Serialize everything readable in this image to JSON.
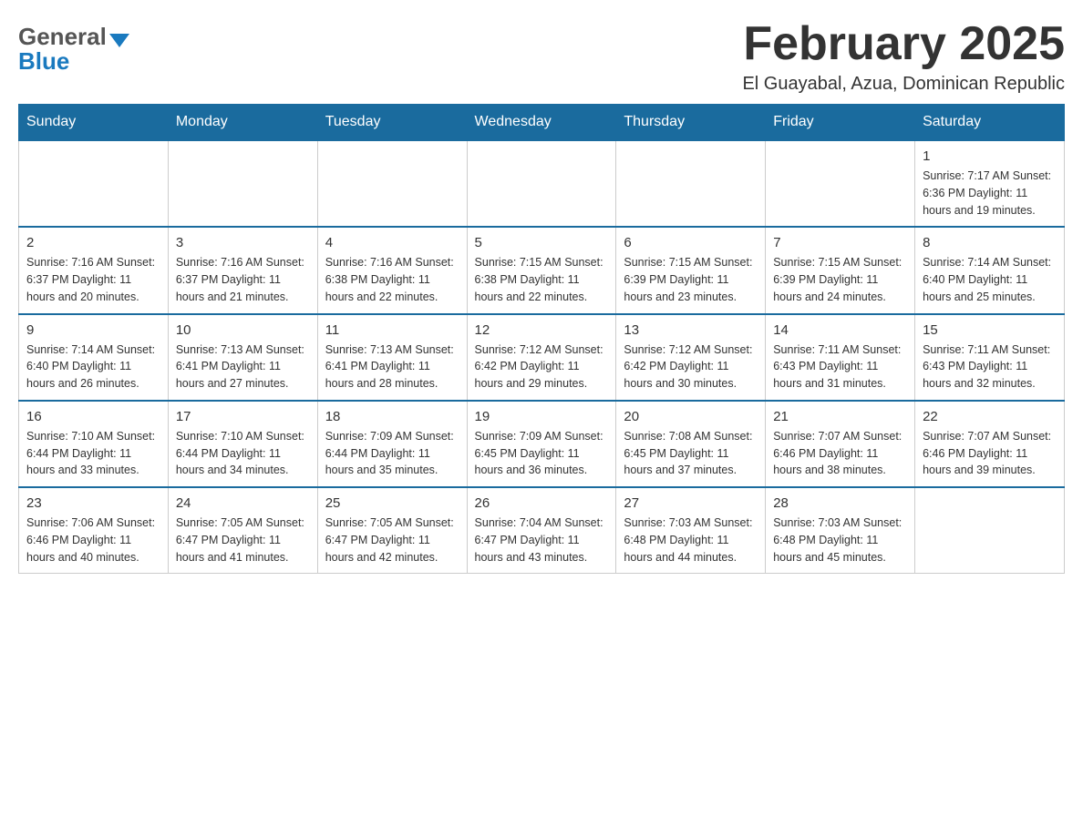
{
  "header": {
    "logo_line1": "General",
    "logo_line2": "Blue",
    "month_title": "February 2025",
    "location": "El Guayabal, Azua, Dominican Republic"
  },
  "weekdays": [
    "Sunday",
    "Monday",
    "Tuesday",
    "Wednesday",
    "Thursday",
    "Friday",
    "Saturday"
  ],
  "weeks": [
    [
      {
        "day": "",
        "info": ""
      },
      {
        "day": "",
        "info": ""
      },
      {
        "day": "",
        "info": ""
      },
      {
        "day": "",
        "info": ""
      },
      {
        "day": "",
        "info": ""
      },
      {
        "day": "",
        "info": ""
      },
      {
        "day": "1",
        "info": "Sunrise: 7:17 AM\nSunset: 6:36 PM\nDaylight: 11 hours and 19 minutes."
      }
    ],
    [
      {
        "day": "2",
        "info": "Sunrise: 7:16 AM\nSunset: 6:37 PM\nDaylight: 11 hours and 20 minutes."
      },
      {
        "day": "3",
        "info": "Sunrise: 7:16 AM\nSunset: 6:37 PM\nDaylight: 11 hours and 21 minutes."
      },
      {
        "day": "4",
        "info": "Sunrise: 7:16 AM\nSunset: 6:38 PM\nDaylight: 11 hours and 22 minutes."
      },
      {
        "day": "5",
        "info": "Sunrise: 7:15 AM\nSunset: 6:38 PM\nDaylight: 11 hours and 22 minutes."
      },
      {
        "day": "6",
        "info": "Sunrise: 7:15 AM\nSunset: 6:39 PM\nDaylight: 11 hours and 23 minutes."
      },
      {
        "day": "7",
        "info": "Sunrise: 7:15 AM\nSunset: 6:39 PM\nDaylight: 11 hours and 24 minutes."
      },
      {
        "day": "8",
        "info": "Sunrise: 7:14 AM\nSunset: 6:40 PM\nDaylight: 11 hours and 25 minutes."
      }
    ],
    [
      {
        "day": "9",
        "info": "Sunrise: 7:14 AM\nSunset: 6:40 PM\nDaylight: 11 hours and 26 minutes."
      },
      {
        "day": "10",
        "info": "Sunrise: 7:13 AM\nSunset: 6:41 PM\nDaylight: 11 hours and 27 minutes."
      },
      {
        "day": "11",
        "info": "Sunrise: 7:13 AM\nSunset: 6:41 PM\nDaylight: 11 hours and 28 minutes."
      },
      {
        "day": "12",
        "info": "Sunrise: 7:12 AM\nSunset: 6:42 PM\nDaylight: 11 hours and 29 minutes."
      },
      {
        "day": "13",
        "info": "Sunrise: 7:12 AM\nSunset: 6:42 PM\nDaylight: 11 hours and 30 minutes."
      },
      {
        "day": "14",
        "info": "Sunrise: 7:11 AM\nSunset: 6:43 PM\nDaylight: 11 hours and 31 minutes."
      },
      {
        "day": "15",
        "info": "Sunrise: 7:11 AM\nSunset: 6:43 PM\nDaylight: 11 hours and 32 minutes."
      }
    ],
    [
      {
        "day": "16",
        "info": "Sunrise: 7:10 AM\nSunset: 6:44 PM\nDaylight: 11 hours and 33 minutes."
      },
      {
        "day": "17",
        "info": "Sunrise: 7:10 AM\nSunset: 6:44 PM\nDaylight: 11 hours and 34 minutes."
      },
      {
        "day": "18",
        "info": "Sunrise: 7:09 AM\nSunset: 6:44 PM\nDaylight: 11 hours and 35 minutes."
      },
      {
        "day": "19",
        "info": "Sunrise: 7:09 AM\nSunset: 6:45 PM\nDaylight: 11 hours and 36 minutes."
      },
      {
        "day": "20",
        "info": "Sunrise: 7:08 AM\nSunset: 6:45 PM\nDaylight: 11 hours and 37 minutes."
      },
      {
        "day": "21",
        "info": "Sunrise: 7:07 AM\nSunset: 6:46 PM\nDaylight: 11 hours and 38 minutes."
      },
      {
        "day": "22",
        "info": "Sunrise: 7:07 AM\nSunset: 6:46 PM\nDaylight: 11 hours and 39 minutes."
      }
    ],
    [
      {
        "day": "23",
        "info": "Sunrise: 7:06 AM\nSunset: 6:46 PM\nDaylight: 11 hours and 40 minutes."
      },
      {
        "day": "24",
        "info": "Sunrise: 7:05 AM\nSunset: 6:47 PM\nDaylight: 11 hours and 41 minutes."
      },
      {
        "day": "25",
        "info": "Sunrise: 7:05 AM\nSunset: 6:47 PM\nDaylight: 11 hours and 42 minutes."
      },
      {
        "day": "26",
        "info": "Sunrise: 7:04 AM\nSunset: 6:47 PM\nDaylight: 11 hours and 43 minutes."
      },
      {
        "day": "27",
        "info": "Sunrise: 7:03 AM\nSunset: 6:48 PM\nDaylight: 11 hours and 44 minutes."
      },
      {
        "day": "28",
        "info": "Sunrise: 7:03 AM\nSunset: 6:48 PM\nDaylight: 11 hours and 45 minutes."
      },
      {
        "day": "",
        "info": ""
      }
    ]
  ]
}
